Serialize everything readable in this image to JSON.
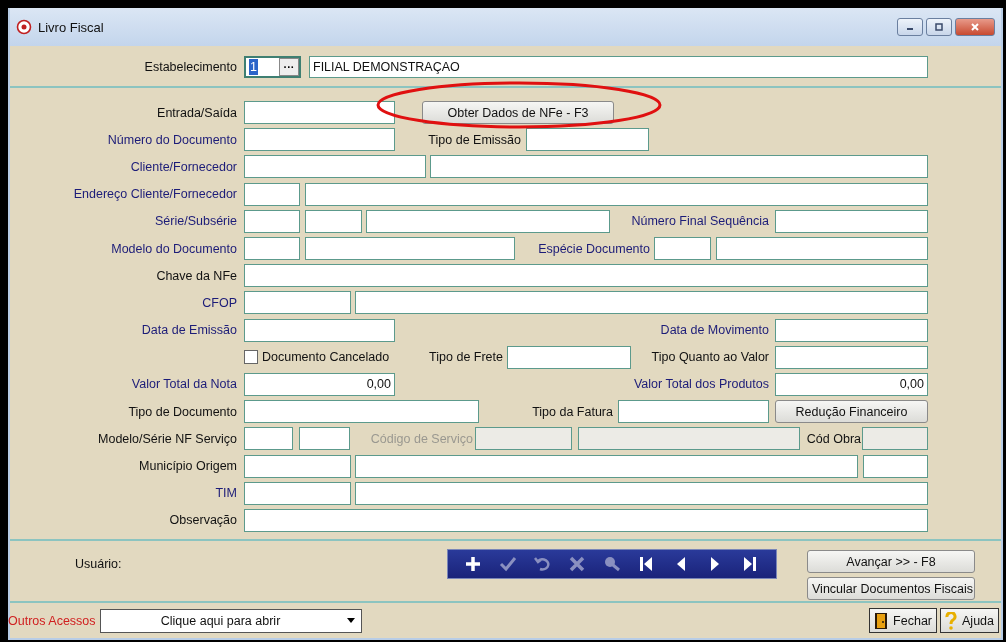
{
  "window": {
    "title": "Livro Fiscal"
  },
  "header": {
    "label": "Estabelecimento",
    "code": "1",
    "browse": "···",
    "name": "FILIAL DEMONSTRAÇAO"
  },
  "rows": [
    {
      "label": {
        "text": "Entrada/Saída",
        "highlighted": false
      },
      "items": [
        {
          "kind": "field",
          "disabled": false
        },
        {
          "kind": "button",
          "text": "Obter Dados de NFe -  F3"
        }
      ]
    },
    {
      "label": {
        "text": "Número do Documento",
        "highlighted": true
      },
      "items": [
        {
          "kind": "field",
          "disabled": false
        },
        {
          "kind": "label",
          "text": "Tipo de Emissão",
          "highlighted": false,
          "disabled": false
        },
        {
          "kind": "field",
          "disabled": false
        }
      ]
    },
    {
      "label": {
        "text": "Cliente/Fornecedor",
        "highlighted": true
      },
      "items": [
        {
          "kind": "field",
          "disabled": false
        },
        {
          "kind": "field",
          "disabled": false
        }
      ]
    },
    {
      "label": {
        "text": "Endereço Cliente/Fornecedor",
        "highlighted": true
      },
      "items": [
        {
          "kind": "field",
          "disabled": false
        },
        {
          "kind": "field",
          "disabled": false
        }
      ]
    },
    {
      "label": {
        "text": "Série/Subsérie",
        "highlighted": true
      },
      "items": [
        {
          "kind": "field",
          "disabled": false
        },
        {
          "kind": "field",
          "disabled": false
        },
        {
          "kind": "field",
          "disabled": false
        },
        {
          "kind": "label",
          "text": "Número Final Sequência",
          "highlighted": true,
          "disabled": false
        },
        {
          "kind": "field",
          "disabled": false
        }
      ]
    },
    {
      "label": {
        "text": "Modelo do Documento",
        "highlighted": true
      },
      "items": [
        {
          "kind": "field",
          "disabled": false
        },
        {
          "kind": "field",
          "disabled": false
        },
        {
          "kind": "label",
          "text": "Espécie Documento",
          "highlighted": true,
          "disabled": false
        },
        {
          "kind": "field",
          "disabled": false
        },
        {
          "kind": "field",
          "disabled": false
        }
      ]
    },
    {
      "label": {
        "text": "Chave da NFe",
        "highlighted": false
      },
      "items": [
        {
          "kind": "field",
          "disabled": false
        }
      ]
    },
    {
      "label": {
        "text": "CFOP",
        "highlighted": true
      },
      "items": [
        {
          "kind": "field",
          "disabled": false
        },
        {
          "kind": "field",
          "disabled": false
        }
      ]
    },
    {
      "label": {
        "text": "Data de Emissão",
        "highlighted": true
      },
      "items": [
        {
          "kind": "field",
          "disabled": false
        },
        {
          "kind": "label",
          "text": "Data de Movimento",
          "highlighted": true,
          "disabled": false
        },
        {
          "kind": "field",
          "disabled": false
        }
      ]
    },
    {
      "items": [
        {
          "kind": "checkbox",
          "text": "Documento Cancelado",
          "checked": false
        },
        {
          "kind": "label",
          "text": "Tipo de Frete",
          "highlighted": false,
          "disabled": false
        },
        {
          "kind": "field",
          "disabled": false
        },
        {
          "kind": "label",
          "text": "Tipo Quanto ao Valor",
          "highlighted": false,
          "disabled": false
        },
        {
          "kind": "field",
          "disabled": false
        }
      ]
    },
    {
      "label": {
        "text": "Valor Total da Nota",
        "highlighted": true
      },
      "items": [
        {
          "kind": "number-field",
          "value": "0,00",
          "disabled": false
        },
        {
          "kind": "label",
          "text": "Valor Total dos Produtos",
          "highlighted": true,
          "disabled": false
        },
        {
          "kind": "number-field",
          "value": "0,00",
          "disabled": false
        }
      ]
    },
    {
      "label": {
        "text": "Tipo de Documento",
        "highlighted": false
      },
      "items": [
        {
          "kind": "field",
          "disabled": false
        },
        {
          "kind": "label",
          "text": "Tipo da Fatura",
          "highlighted": false,
          "disabled": false
        },
        {
          "kind": "field",
          "disabled": false
        },
        {
          "kind": "button",
          "text": "Redução Financeiro"
        }
      ]
    },
    {
      "label": {
        "text": "Modelo/Série NF Serviço",
        "highlighted": false
      },
      "items": [
        {
          "kind": "field",
          "disabled": false
        },
        {
          "kind": "field",
          "disabled": false
        },
        {
          "kind": "label",
          "text": "Código de Serviço",
          "highlighted": false,
          "disabled": true
        },
        {
          "kind": "field",
          "disabled": true
        },
        {
          "kind": "field",
          "disabled": true
        },
        {
          "kind": "label",
          "text": "Cód Obra",
          "highlighted": false,
          "disabled": false
        },
        {
          "kind": "field",
          "disabled": true
        }
      ]
    },
    {
      "label": {
        "text": "Município Origem",
        "highlighted": false
      },
      "items": [
        {
          "kind": "field",
          "disabled": false
        },
        {
          "kind": "field",
          "disabled": false
        },
        {
          "kind": "field",
          "disabled": false
        }
      ]
    },
    {
      "label": {
        "text": "TIM",
        "highlighted": true
      },
      "items": [
        {
          "kind": "field",
          "disabled": false
        },
        {
          "kind": "field",
          "disabled": false
        }
      ]
    },
    {
      "label": {
        "text": "Observação",
        "highlighted": false
      },
      "items": [
        {
          "kind": "field",
          "disabled": false
        }
      ]
    }
  ],
  "footer": {
    "user_label": "Usuário:",
    "toolbar": [
      {
        "disabled": false
      },
      {
        "disabled": true
      },
      {
        "disabled": true
      },
      {
        "disabled": true
      },
      {
        "disabled": true
      },
      {
        "disabled": false
      },
      {
        "disabled": false
      },
      {
        "disabled": false
      },
      {
        "disabled": false
      }
    ],
    "buttons": [
      "Avançar >> - F8",
      "Vincular Documentos Fiscais"
    ],
    "other_label": "Outros Acessos",
    "dropdown": {
      "value": "Clique aqui para abrir"
    },
    "close_button": "Fechar",
    "help_button": "Ajuda"
  }
}
